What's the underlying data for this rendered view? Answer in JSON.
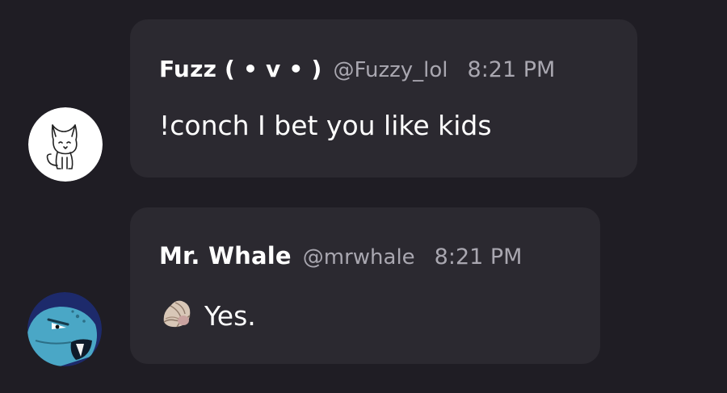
{
  "messages": [
    {
      "author": "Fuzz ( • v • )",
      "handle": "@Fuzzy_lol",
      "time": "8:21 PM",
      "text": "!conch I bet you like kids",
      "avatar_icon": "cat-avatar-icon"
    },
    {
      "author": "Mr. Whale",
      "handle": "@mrwhale",
      "time": "8:21 PM",
      "text": "Yes.",
      "emoji_icon": "spiral-shell-icon",
      "avatar_icon": "whale-avatar-icon"
    }
  ],
  "colors": {
    "background": "#1f1d24",
    "bubble": "#2b2930",
    "muted_text": "#a9a7b0",
    "text": "#ffffff"
  }
}
